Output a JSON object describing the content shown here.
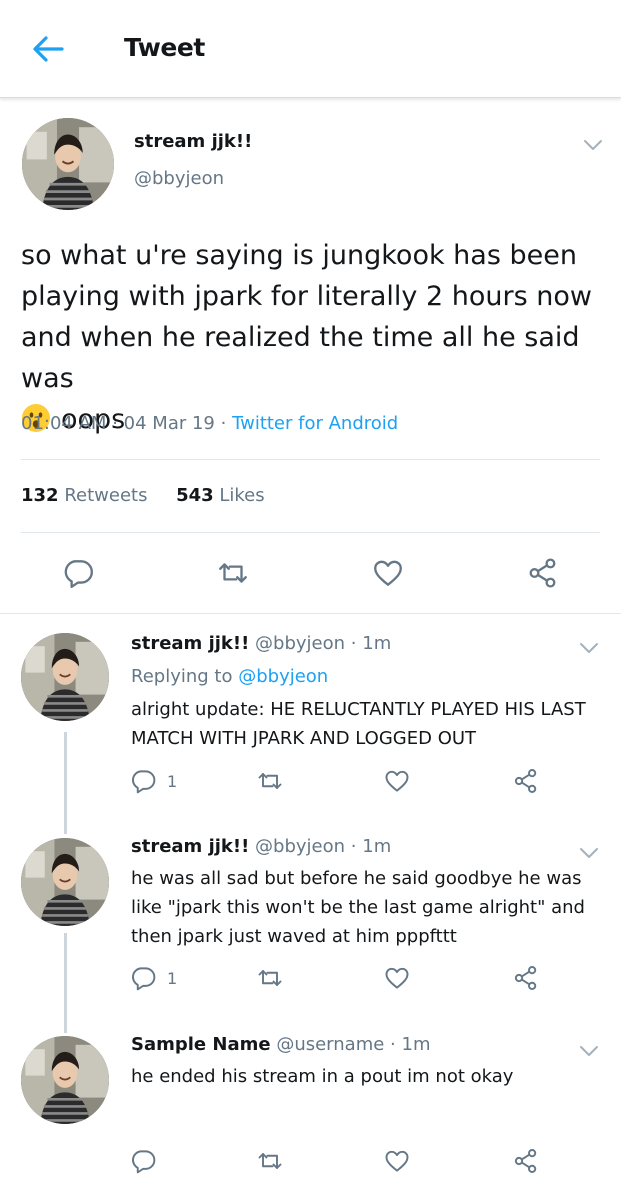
{
  "header": {
    "title": "Tweet"
  },
  "main_tweet": {
    "name": "stream jjk!!",
    "handle": "@bbyjeon",
    "text": "so what u're saying is jungkook has been playing with jpark for literally 2 hours now and when he realized the time all he said was",
    "text_after_emoji": "oops",
    "emoji": "hushed-face-emoji",
    "time": "01:04 AM",
    "date": "04 Mar 19",
    "separator": "·",
    "source": "Twitter for Android",
    "retweets_count": "132",
    "retweets_label": "Retweets",
    "likes_count": "543",
    "likes_label": "Likes"
  },
  "replies": [
    {
      "name": "stream jjk!!",
      "handle": "@bbyjeon",
      "time": "1m",
      "replying_prefix": "Replying to",
      "replying_handle": "@bbyjeon",
      "text": "alright update: HE RELUCTANTLY PLAYED HIS LAST MATCH WITH JPARK AND LOGGED OUT",
      "reply_count": "1"
    },
    {
      "name": "stream jjk!!",
      "handle": "@bbyjeon",
      "time": "1m",
      "text": "he was all sad but before he said goodbye he was like \"jpark this won't be the last game alright\" and then jpark just waved at him pppfttt",
      "reply_count": "1"
    },
    {
      "name": "Sample Name",
      "handle": "@username",
      "time": "1m",
      "text": "he ended his stream in a pout im not okay",
      "reply_count": ""
    }
  ],
  "icons": {
    "back": "arrow-left-icon",
    "menu": "chevron-down-icon",
    "reply": "speech-bubble-icon",
    "retweet": "retweet-icon",
    "like": "heart-icon",
    "share": "share-icon"
  },
  "colors": {
    "accent": "#1da1f2",
    "text": "#14171a",
    "secondary": "#657786",
    "icon": "#657786",
    "divider": "#e1e8ed"
  }
}
